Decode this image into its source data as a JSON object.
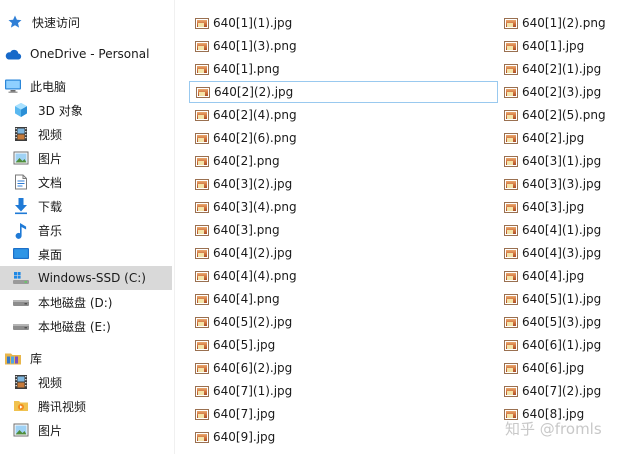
{
  "nav": {
    "items": [
      {
        "label": "快速访问",
        "icon": "star-icon"
      },
      {
        "label": "OneDrive - Personal",
        "icon": "cloud-icon"
      },
      {
        "label": "此电脑",
        "icon": "computer-icon"
      },
      {
        "label": "3D 对象",
        "icon": "cube-icon"
      },
      {
        "label": "视频",
        "icon": "film-icon"
      },
      {
        "label": "图片",
        "icon": "picture-icon"
      },
      {
        "label": "文档",
        "icon": "document-icon"
      },
      {
        "label": "下载",
        "icon": "download-icon"
      },
      {
        "label": "音乐",
        "icon": "music-icon"
      },
      {
        "label": "桌面",
        "icon": "desktop-icon"
      },
      {
        "label": "Windows-SSD (C:)",
        "icon": "windows-drive-icon",
        "selected": true
      },
      {
        "label": "本地磁盘 (D:)",
        "icon": "drive-icon"
      },
      {
        "label": "本地磁盘 (E:)",
        "icon": "drive-icon"
      },
      {
        "label": "库",
        "icon": "library-icon"
      },
      {
        "label": "视频",
        "icon": "film-icon"
      },
      {
        "label": "腾讯视频",
        "icon": "folder-icon"
      },
      {
        "label": "图片",
        "icon": "picture-icon"
      }
    ]
  },
  "files": {
    "col1": [
      "640[1](1).jpg",
      "640[1](3).png",
      "640[1].png",
      "640[2](2).jpg",
      "640[2](4).png",
      "640[2](6).png",
      "640[2].png",
      "640[3](2).jpg",
      "640[3](4).png",
      "640[3].png",
      "640[4](2).jpg",
      "640[4](4).png",
      "640[4].png",
      "640[5](2).jpg",
      "640[5].jpg",
      "640[6](2).jpg",
      "640[7](1).jpg",
      "640[7].jpg",
      "640[9].jpg"
    ],
    "col2": [
      "640[1](2).png",
      "640[1].jpg",
      "640[2](1).jpg",
      "640[2](3).jpg",
      "640[2](5).png",
      "640[2].jpg",
      "640[3](1).jpg",
      "640[3](3).jpg",
      "640[3].jpg",
      "640[4](1).jpg",
      "640[4](3).jpg",
      "640[4].jpg",
      "640[5](1).jpg",
      "640[5](3).jpg",
      "640[6](1).jpg",
      "640[6].jpg",
      "640[7](2).jpg",
      "640[8].jpg"
    ],
    "focused": "640[2](2).jpg"
  },
  "watermark": "知乎 @fromls"
}
